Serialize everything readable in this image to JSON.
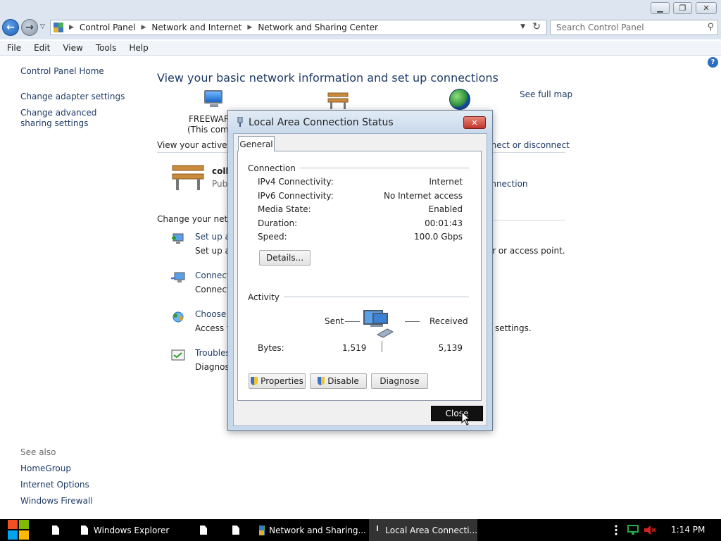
{
  "window": {
    "minimize_icon": "minimize-icon",
    "maximize_icon": "restore-icon",
    "close_icon": "close-icon"
  },
  "address": {
    "breadcrumbs": [
      "Control Panel",
      "Network and Internet",
      "Network and Sharing Center"
    ],
    "search_placeholder": "Search Control Panel"
  },
  "menu": [
    "File",
    "Edit",
    "View",
    "Tools",
    "Help"
  ],
  "sidebar": {
    "items": [
      {
        "label": "Control Panel Home"
      },
      {
        "label": "Change adapter settings"
      },
      {
        "label": "Change advanced sharing settings"
      }
    ],
    "see_also_label": "See also",
    "see_also": [
      {
        "label": "HomeGroup"
      },
      {
        "label": "Internet Options"
      },
      {
        "label": "Windows Firewall"
      }
    ]
  },
  "main": {
    "title": "View your basic network information and set up connections",
    "see_full_map": "See full map",
    "computer_name": "FREEWARE",
    "computer_sub": "(This comp",
    "active_networks": "View your active ne",
    "connect_disconnect": "nnect or disconnect",
    "network_name": "colla",
    "network_type": "Pub",
    "connection_link": "onnection",
    "change_settings": "Change your netwo",
    "tasks": [
      {
        "title": "Set up a",
        "desc": "Set up a",
        "desc_tail": "ter or access point."
      },
      {
        "title": "Connect",
        "desc": "Connect"
      },
      {
        "title": "Choose h",
        "desc": "Access fi",
        "desc_tail": "settings."
      },
      {
        "title": "Troubles",
        "desc": "Diagnose"
      }
    ]
  },
  "dialog": {
    "title": "Local Area Connection Status",
    "tab": "General",
    "connection_group": "Connection",
    "rows": [
      {
        "label": "IPv4 Connectivity:",
        "value": "Internet"
      },
      {
        "label": "IPv6 Connectivity:",
        "value": "No Internet access"
      },
      {
        "label": "Media State:",
        "value": "Enabled"
      },
      {
        "label": "Duration:",
        "value": "00:01:43"
      },
      {
        "label": "Speed:",
        "value": "100.0 Gbps"
      }
    ],
    "details_button": "Details...",
    "activity_group": "Activity",
    "sent_label": "Sent",
    "received_label": "Received",
    "bytes_label": "Bytes:",
    "bytes_sent": "1,519",
    "bytes_received": "5,139",
    "properties_button": "Properties",
    "disable_button": "Disable",
    "diagnose_button": "Diagnose",
    "close_button": "Close"
  },
  "taskbar": {
    "items": [
      {
        "label": ""
      },
      {
        "label": "Windows Explorer"
      },
      {
        "label": ""
      },
      {
        "label": ""
      },
      {
        "label": "Network and Sharing..."
      },
      {
        "label": "Local Area Connecti..."
      }
    ],
    "clock": "1:14 PM"
  },
  "colors": {
    "link": "#1e3b66",
    "accent_blue": "#2b6cc4",
    "dialog_frame": "#c7d8ea",
    "close_red": "#c2352a"
  }
}
